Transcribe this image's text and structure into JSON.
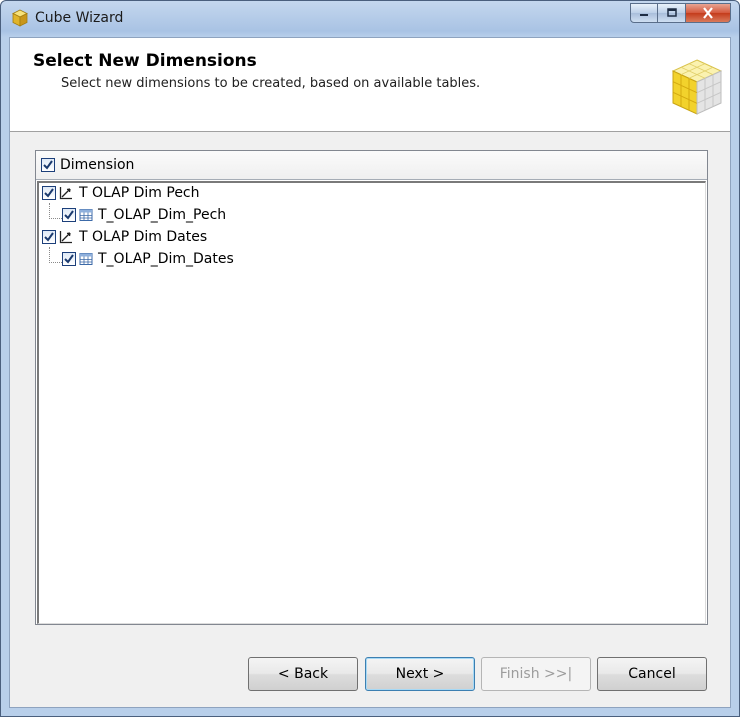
{
  "window": {
    "title": "Cube Wizard"
  },
  "header": {
    "title": "Select New Dimensions",
    "subtitle": "Select new dimensions to be created, based on available tables."
  },
  "tree": {
    "column_header": "Dimension",
    "header_checked": true,
    "items": [
      {
        "label": "T OLAP Dim Pech",
        "checked": true,
        "icon": "dimension-icon",
        "children": [
          {
            "label": "T_OLAP_Dim_Pech",
            "checked": true,
            "icon": "table-icon"
          }
        ]
      },
      {
        "label": "T OLAP Dim Dates",
        "checked": true,
        "icon": "dimension-icon",
        "children": [
          {
            "label": "T_OLAP_Dim_Dates",
            "checked": true,
            "icon": "table-icon"
          }
        ]
      }
    ]
  },
  "buttons": {
    "back": "< Back",
    "next": "Next >",
    "finish": "Finish >>|",
    "cancel": "Cancel"
  }
}
